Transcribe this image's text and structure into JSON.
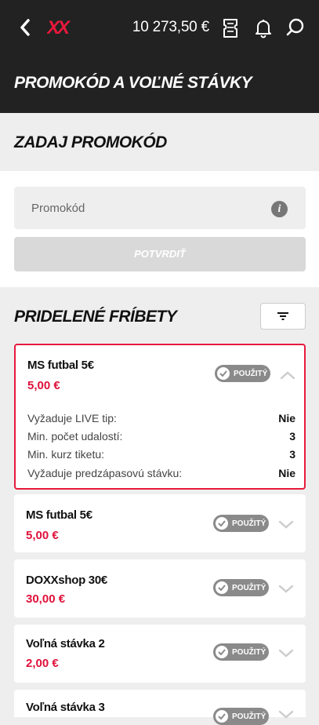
{
  "header": {
    "balance": "10 273,50 €",
    "title": "PROMOKÓD A VOĽNÉ STÁVKY",
    "logo_text": "XX",
    "brand_color": "#e8193c"
  },
  "promo": {
    "heading": "ZADAJ PROMOKÓD",
    "input_placeholder": "Promokód",
    "info_glyph": "i",
    "confirm_label": "POTVRDIŤ"
  },
  "freebets": {
    "heading": "PRIDELENÉ FRÍBETY",
    "items": [
      {
        "name": "MS futbal 5€",
        "amount": "5,00 €",
        "status": "POUŽITÝ",
        "expanded": true,
        "details": [
          {
            "label": "Vyžaduje LIVE tip:",
            "value": "Nie"
          },
          {
            "label": "Min. počet udalostí:",
            "value": "3"
          },
          {
            "label": "Min. kurz tiketu:",
            "value": "3"
          },
          {
            "label": "Vyžaduje predzápasovú stávku:",
            "value": "Nie"
          }
        ]
      },
      {
        "name": "MS futbal 5€",
        "amount": "5,00 €",
        "status": "POUŽITÝ",
        "expanded": false
      },
      {
        "name": "DOXXshop 30€",
        "amount": "30,00 €",
        "status": "POUŽITÝ",
        "expanded": false
      },
      {
        "name": "Voľná stávka 2",
        "amount": "2,00 €",
        "status": "POUŽITÝ",
        "expanded": false
      },
      {
        "name": "Voľná stávka 3",
        "amount": "",
        "status": "POUŽITÝ",
        "expanded": false
      }
    ]
  }
}
